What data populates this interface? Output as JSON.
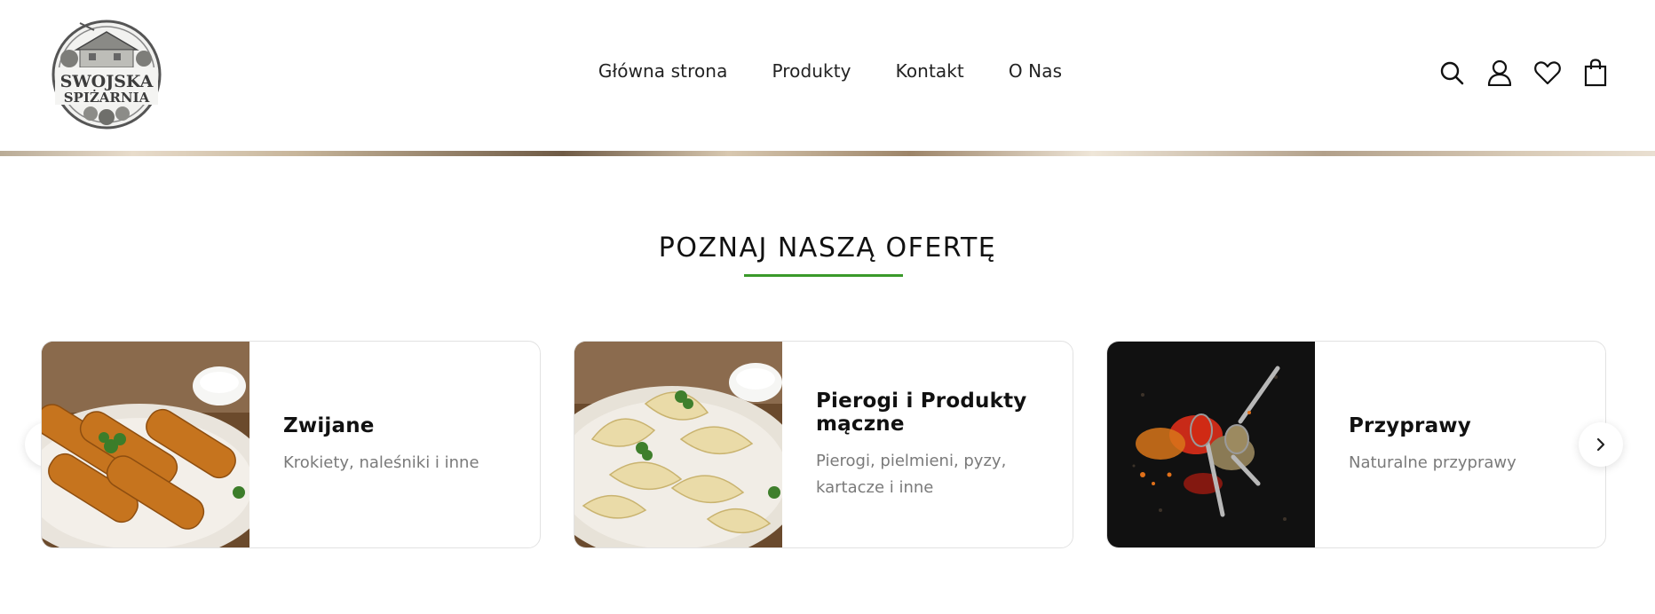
{
  "logo": {
    "line1": "SWOJSKA",
    "line2": "SPIŻARNIA"
  },
  "nav": [
    {
      "label": "Główna strona"
    },
    {
      "label": "Produkty"
    },
    {
      "label": "Kontakt"
    },
    {
      "label": "O Nas"
    }
  ],
  "header_icons": [
    "search-icon",
    "user-icon",
    "heart-icon",
    "shopping-bag-icon"
  ],
  "section": {
    "title": "POZNAJ NASZĄ OFERTĘ",
    "accent_color": "#3a9a2a"
  },
  "categories": [
    {
      "title": "Zwijane",
      "description": "Krokiety, naleśniki i inne",
      "image": "croquettes-photo"
    },
    {
      "title": "Pierogi i Produkty mączne",
      "description": "Pierogi, pielmieni, pyzy, kartacze i inne",
      "image": "pierogi-photo"
    },
    {
      "title": "Przyprawy",
      "description": "Naturalne przyprawy",
      "image": "spices-photo"
    }
  ],
  "carousel": {
    "prev_icon": "chevron-left-icon",
    "next_icon": "chevron-right-icon"
  }
}
